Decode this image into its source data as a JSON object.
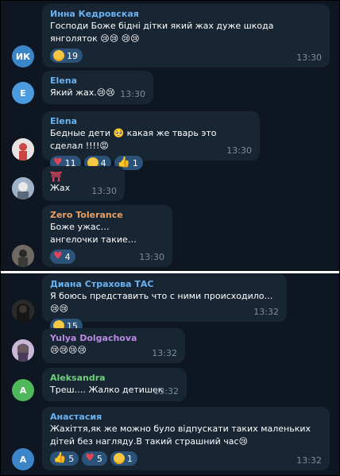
{
  "messages": [
    {
      "id": "m1",
      "name": "Инна Кедровская",
      "name_color": "#6ab3f3",
      "avatar_text": "ИК",
      "avatar_color": "#3b86c9",
      "text": "Господи Боже бідні дітки який жах дуже шкода янголяток 😢😢 😢😢",
      "time": "13:30",
      "reactions": [
        {
          "icon": "cry-emoji-icon",
          "count": "19"
        }
      ]
    },
    {
      "id": "m2",
      "name": "Elena",
      "name_color": "#6ab3f3",
      "avatar_text": "E",
      "avatar_color": "#4a9be0",
      "text": "Який жах.😢😢",
      "time": "13:30",
      "reactions": []
    },
    {
      "id": "m3",
      "name": "Elena",
      "name_color": "#6ab3f3",
      "avatar_text": "",
      "avatar_color": "#c46a6a",
      "text": "Бедные дети 🥺 какая же тварь это сделал !!!!😡",
      "time": "13:30",
      "reactions": [
        {
          "icon": "heart-icon",
          "count": "11"
        },
        {
          "icon": "cry-emoji-icon",
          "count": "4"
        },
        {
          "icon": "thumbs-up-icon",
          "count": "1"
        }
      ]
    },
    {
      "id": "m4",
      "name": "⛩",
      "name_color": "#e0455a",
      "avatar_text": "",
      "avatar_color": "#8aa0b8",
      "text": "Жах",
      "time": "13:30",
      "reactions": []
    },
    {
      "id": "m5",
      "name": "Zero Tolerance",
      "name_color": "#e8a064",
      "avatar_text": "",
      "avatar_color": "#5a5a5a",
      "text": "Боже ужас…\nангелочки такие…",
      "time": "13:30",
      "reactions": [
        {
          "icon": "heart-icon",
          "count": "4"
        }
      ]
    },
    {
      "id": "m6",
      "name": "Диана Страхова ТАС",
      "name_color": "#6ab3f3",
      "avatar_text": "",
      "avatar_color": "#3a3a3a",
      "text": "Я боюсь представить что с ними происходило…😢😢",
      "time": "13:32",
      "reactions": [
        {
          "icon": "cry-emoji-icon",
          "count": "15"
        }
      ]
    },
    {
      "id": "m7",
      "name": "Yulya Dolgachova",
      "name_color": "#b98be0",
      "avatar_text": "",
      "avatar_color": "#7a5a8a",
      "text": "😢😢😢😢",
      "time": "13:32",
      "reactions": []
    },
    {
      "id": "m8",
      "name": "Aleksandra",
      "name_color": "#6fcf7a",
      "avatar_text": "A",
      "avatar_color": "#4fb85a",
      "text": "Треш…. Жалко детишек",
      "time": "13:32",
      "reactions": []
    },
    {
      "id": "m9",
      "name": "Анастасия",
      "name_color": "#6ab3f3",
      "avatar_text": "A",
      "avatar_color": "#3b86c9",
      "text": "Жахіття,як же можно було відпускати таких маленьких дітей без нагляду.В такий страшний час😢",
      "time": "13:32",
      "reactions": [
        {
          "icon": "thumbs-up-icon",
          "count": "5"
        },
        {
          "icon": "heart-icon",
          "count": "5"
        },
        {
          "icon": "cry-emoji-icon",
          "count": "1"
        }
      ]
    }
  ]
}
